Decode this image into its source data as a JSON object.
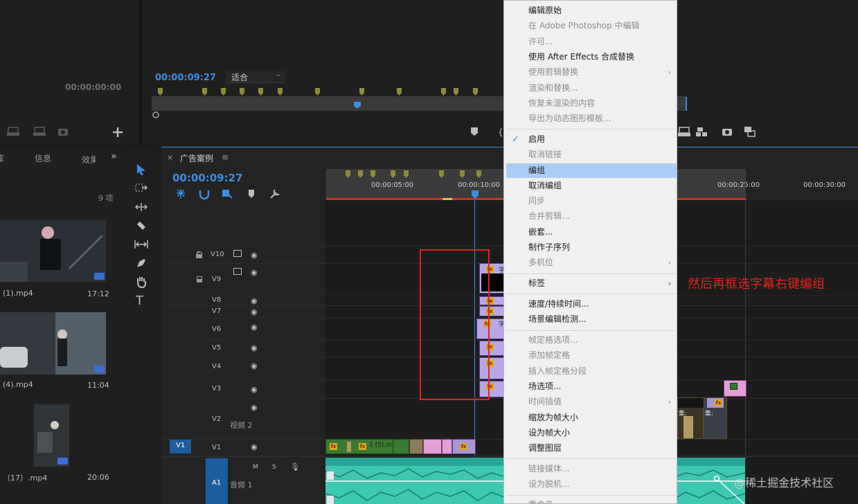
{
  "source_monitor": {
    "timecode": "00:00:00:00"
  },
  "program_monitor": {
    "timecode": "00:00:09:27",
    "zoom": "适合"
  },
  "project_panel": {
    "tabs": [
      "库",
      "信息",
      "效果"
    ],
    "item_count": "9 项",
    "items": [
      {
        "name": "(1).mp4",
        "duration": "17:12"
      },
      {
        "name": "(4).mp4",
        "duration": "11:04"
      },
      {
        "name": "（17）.mp4",
        "duration": "20:06"
      }
    ]
  },
  "timeline": {
    "tab": "广告案例",
    "timecode": "00:00:09:27",
    "ruler": [
      "00:00:05:00",
      "00:00:10:00",
      "00:00:25:00",
      "00:00:30:00"
    ],
    "tracks": [
      {
        "id": "V10",
        "label": "V10"
      },
      {
        "id": "V9",
        "label": "V9"
      },
      {
        "id": "V8",
        "label": "V8"
      },
      {
        "id": "V7",
        "label": "V7"
      },
      {
        "id": "V6",
        "label": "V6"
      },
      {
        "id": "V5",
        "label": "V5"
      },
      {
        "id": "V4",
        "label": "V4"
      },
      {
        "id": "V3",
        "label": "V3"
      },
      {
        "id": "V2",
        "label": "V2",
        "name": "视频 2"
      },
      {
        "id": "V1",
        "label": "V1",
        "source": "V1"
      },
      {
        "id": "A1",
        "label": "A1",
        "name": "音频 1",
        "buttons": [
          "M",
          "S"
        ]
      }
    ],
    "clip_labels": {
      "v1_clip": "1 (5).m",
      "subtitle": "字",
      "v2_a": "集:",
      "v2_b": "集:"
    }
  },
  "context_menu": {
    "items": [
      {
        "label": "编辑原始",
        "enabled": true
      },
      {
        "label": "在 Adobe Photoshop 中编辑",
        "enabled": false
      },
      {
        "label": "许可...",
        "enabled": false
      },
      {
        "label": "使用 After Effects 合成替换",
        "enabled": true
      },
      {
        "label": "使用剪辑替换",
        "enabled": false,
        "submenu": true
      },
      {
        "label": "渲染和替换...",
        "enabled": false
      },
      {
        "label": "恢复未渲染的内容",
        "enabled": false
      },
      {
        "label": "导出为动态图形模板...",
        "enabled": false
      },
      {
        "separator": true
      },
      {
        "label": "启用",
        "enabled": true,
        "checked": true
      },
      {
        "label": "取消链接",
        "enabled": false
      },
      {
        "label": "编组",
        "enabled": true,
        "highlighted": true
      },
      {
        "label": "取消编组",
        "enabled": true
      },
      {
        "label": "同步",
        "enabled": false
      },
      {
        "label": "合并剪辑...",
        "enabled": false
      },
      {
        "label": "嵌套...",
        "enabled": true
      },
      {
        "label": "制作子序列",
        "enabled": true
      },
      {
        "label": "多机位",
        "enabled": false,
        "submenu": true
      },
      {
        "separator": true
      },
      {
        "label": "标签",
        "enabled": true,
        "submenu": true
      },
      {
        "separator": true
      },
      {
        "label": "速度/持续时间...",
        "enabled": true
      },
      {
        "label": "场景编辑检测...",
        "enabled": true
      },
      {
        "separator": true
      },
      {
        "label": "帧定格选项...",
        "enabled": false
      },
      {
        "label": "添加帧定格",
        "enabled": false
      },
      {
        "label": "插入帧定格分段",
        "enabled": false
      },
      {
        "label": "场选项...",
        "enabled": true
      },
      {
        "label": "时间插值",
        "enabled": false,
        "submenu": true
      },
      {
        "label": "缩放为帧大小",
        "enabled": true
      },
      {
        "label": "设为帧大小",
        "enabled": true
      },
      {
        "label": "调整图层",
        "enabled": true
      },
      {
        "separator": true
      },
      {
        "label": "链接媒体...",
        "enabled": false
      },
      {
        "label": "设为脱机...",
        "enabled": false
      },
      {
        "separator": true
      },
      {
        "label": "重命名...",
        "enabled": false
      }
    ]
  },
  "annotation": {
    "text": "然后再框选字幕右键编组",
    "color": "#e0241d"
  },
  "watermark": "@稀土掘金技术社区",
  "colors": {
    "accent": "#3b8ee4",
    "clip_purple": "#a994d6",
    "clip_green": "#3a7a32",
    "clip_pink": "#e29ed6",
    "audio": "#2bb3a5",
    "menu_highlight": "#a9cdf5"
  }
}
